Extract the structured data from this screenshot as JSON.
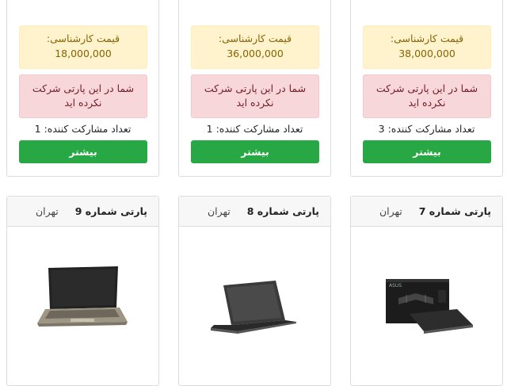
{
  "top_cards": [
    {
      "price_label": "قیمت کارشناسی:",
      "price_value": "18,000,000",
      "alert_text": "شما در این پارتی شرکت نکرده اید",
      "participants": "تعداد مشارکت کننده: 1",
      "more_label": "بیشتر"
    },
    {
      "price_label": "قیمت کارشناسی:",
      "price_value": "36,000,000",
      "alert_text": "شما در این پارتی شرکت نکرده اید",
      "participants": "تعداد مشارکت کننده: 1",
      "more_label": "بیشتر"
    },
    {
      "price_label": "قیمت کارشناسی:",
      "price_value": "38,000,000",
      "alert_text": "شما در این پارتی شرکت نکرده اید",
      "participants": "تعداد مشارکت کننده: 3",
      "more_label": "بیشتر"
    }
  ],
  "bottom_cards": [
    {
      "title": "پارتی شماره 9",
      "city": "تهران",
      "image": "laptop-silver-icon"
    },
    {
      "title": "پارتی شماره 8",
      "city": "تهران",
      "image": "laptop-dark-icon"
    },
    {
      "title": "پارتی شماره 7",
      "city": "تهران",
      "image": "laptop-box-icon"
    }
  ],
  "colors": {
    "warning_bg": "#fff3cd",
    "warning_text": "#856404",
    "danger_bg": "#f8d7da",
    "danger_text": "#721c24",
    "success": "#28a745"
  }
}
